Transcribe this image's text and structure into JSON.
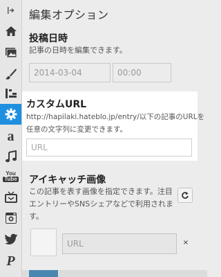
{
  "panel": {
    "title": "編集オプション"
  },
  "date_section": {
    "heading": "投稿日時",
    "description": "記事の日時を編集できます。",
    "date_value": "2014-03-04",
    "time_placeholder": "00:00"
  },
  "custom_url_section": {
    "heading": "カスタムURL",
    "description_line1": "http://hapilaki.hateblo.jp/entry/以下の記事のURLを",
    "description_line2": "任意の文字列に変更できます。",
    "input_placeholder": "URL"
  },
  "eyecatch_section": {
    "heading": "アイキャッチ画像",
    "description_line1": "この記事を表す画像を指定できます。注目",
    "description_line2": "エントリーやSNSシェアなどで利用されま",
    "description_line3": "す。",
    "url_placeholder": "URL",
    "close_label": "×"
  },
  "rail": {
    "items": [
      "home-icon",
      "picture-icon",
      "brush-icon",
      "layout-icon",
      "gear-icon",
      "amazon-icon",
      "music-icon",
      "youtube-icon",
      "tv-icon",
      "instagram-icon",
      "twitter-icon",
      "pinterest-icon"
    ],
    "youtube_text": "You Tube",
    "amazon_letter": "a",
    "pinterest_letter": "P",
    "active_color": "#1f8fe0"
  }
}
